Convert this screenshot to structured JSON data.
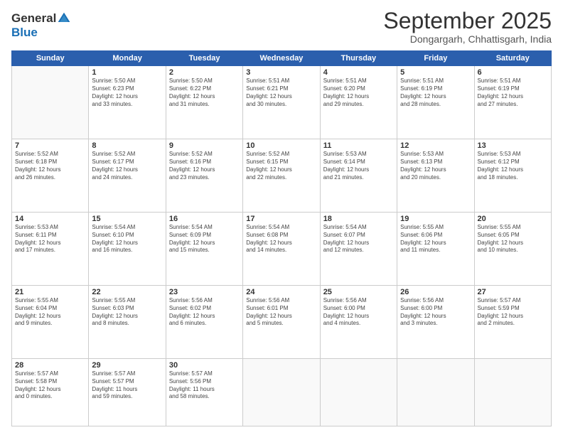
{
  "header": {
    "logo_general": "General",
    "logo_blue": "Blue",
    "month": "September 2025",
    "location": "Dongargarh, Chhattisgarh, India"
  },
  "weekdays": [
    "Sunday",
    "Monday",
    "Tuesday",
    "Wednesday",
    "Thursday",
    "Friday",
    "Saturday"
  ],
  "weeks": [
    [
      {
        "day": "",
        "info": ""
      },
      {
        "day": "1",
        "info": "Sunrise: 5:50 AM\nSunset: 6:23 PM\nDaylight: 12 hours\nand 33 minutes."
      },
      {
        "day": "2",
        "info": "Sunrise: 5:50 AM\nSunset: 6:22 PM\nDaylight: 12 hours\nand 31 minutes."
      },
      {
        "day": "3",
        "info": "Sunrise: 5:51 AM\nSunset: 6:21 PM\nDaylight: 12 hours\nand 30 minutes."
      },
      {
        "day": "4",
        "info": "Sunrise: 5:51 AM\nSunset: 6:20 PM\nDaylight: 12 hours\nand 29 minutes."
      },
      {
        "day": "5",
        "info": "Sunrise: 5:51 AM\nSunset: 6:19 PM\nDaylight: 12 hours\nand 28 minutes."
      },
      {
        "day": "6",
        "info": "Sunrise: 5:51 AM\nSunset: 6:19 PM\nDaylight: 12 hours\nand 27 minutes."
      }
    ],
    [
      {
        "day": "7",
        "info": "Sunrise: 5:52 AM\nSunset: 6:18 PM\nDaylight: 12 hours\nand 26 minutes."
      },
      {
        "day": "8",
        "info": "Sunrise: 5:52 AM\nSunset: 6:17 PM\nDaylight: 12 hours\nand 24 minutes."
      },
      {
        "day": "9",
        "info": "Sunrise: 5:52 AM\nSunset: 6:16 PM\nDaylight: 12 hours\nand 23 minutes."
      },
      {
        "day": "10",
        "info": "Sunrise: 5:52 AM\nSunset: 6:15 PM\nDaylight: 12 hours\nand 22 minutes."
      },
      {
        "day": "11",
        "info": "Sunrise: 5:53 AM\nSunset: 6:14 PM\nDaylight: 12 hours\nand 21 minutes."
      },
      {
        "day": "12",
        "info": "Sunrise: 5:53 AM\nSunset: 6:13 PM\nDaylight: 12 hours\nand 20 minutes."
      },
      {
        "day": "13",
        "info": "Sunrise: 5:53 AM\nSunset: 6:12 PM\nDaylight: 12 hours\nand 18 minutes."
      }
    ],
    [
      {
        "day": "14",
        "info": "Sunrise: 5:53 AM\nSunset: 6:11 PM\nDaylight: 12 hours\nand 17 minutes."
      },
      {
        "day": "15",
        "info": "Sunrise: 5:54 AM\nSunset: 6:10 PM\nDaylight: 12 hours\nand 16 minutes."
      },
      {
        "day": "16",
        "info": "Sunrise: 5:54 AM\nSunset: 6:09 PM\nDaylight: 12 hours\nand 15 minutes."
      },
      {
        "day": "17",
        "info": "Sunrise: 5:54 AM\nSunset: 6:08 PM\nDaylight: 12 hours\nand 14 minutes."
      },
      {
        "day": "18",
        "info": "Sunrise: 5:54 AM\nSunset: 6:07 PM\nDaylight: 12 hours\nand 12 minutes."
      },
      {
        "day": "19",
        "info": "Sunrise: 5:55 AM\nSunset: 6:06 PM\nDaylight: 12 hours\nand 11 minutes."
      },
      {
        "day": "20",
        "info": "Sunrise: 5:55 AM\nSunset: 6:05 PM\nDaylight: 12 hours\nand 10 minutes."
      }
    ],
    [
      {
        "day": "21",
        "info": "Sunrise: 5:55 AM\nSunset: 6:04 PM\nDaylight: 12 hours\nand 9 minutes."
      },
      {
        "day": "22",
        "info": "Sunrise: 5:55 AM\nSunset: 6:03 PM\nDaylight: 12 hours\nand 8 minutes."
      },
      {
        "day": "23",
        "info": "Sunrise: 5:56 AM\nSunset: 6:02 PM\nDaylight: 12 hours\nand 6 minutes."
      },
      {
        "day": "24",
        "info": "Sunrise: 5:56 AM\nSunset: 6:01 PM\nDaylight: 12 hours\nand 5 minutes."
      },
      {
        "day": "25",
        "info": "Sunrise: 5:56 AM\nSunset: 6:00 PM\nDaylight: 12 hours\nand 4 minutes."
      },
      {
        "day": "26",
        "info": "Sunrise: 5:56 AM\nSunset: 6:00 PM\nDaylight: 12 hours\nand 3 minutes."
      },
      {
        "day": "27",
        "info": "Sunrise: 5:57 AM\nSunset: 5:59 PM\nDaylight: 12 hours\nand 2 minutes."
      }
    ],
    [
      {
        "day": "28",
        "info": "Sunrise: 5:57 AM\nSunset: 5:58 PM\nDaylight: 12 hours\nand 0 minutes."
      },
      {
        "day": "29",
        "info": "Sunrise: 5:57 AM\nSunset: 5:57 PM\nDaylight: 11 hours\nand 59 minutes."
      },
      {
        "day": "30",
        "info": "Sunrise: 5:57 AM\nSunset: 5:56 PM\nDaylight: 11 hours\nand 58 minutes."
      },
      {
        "day": "",
        "info": ""
      },
      {
        "day": "",
        "info": ""
      },
      {
        "day": "",
        "info": ""
      },
      {
        "day": "",
        "info": ""
      }
    ]
  ]
}
